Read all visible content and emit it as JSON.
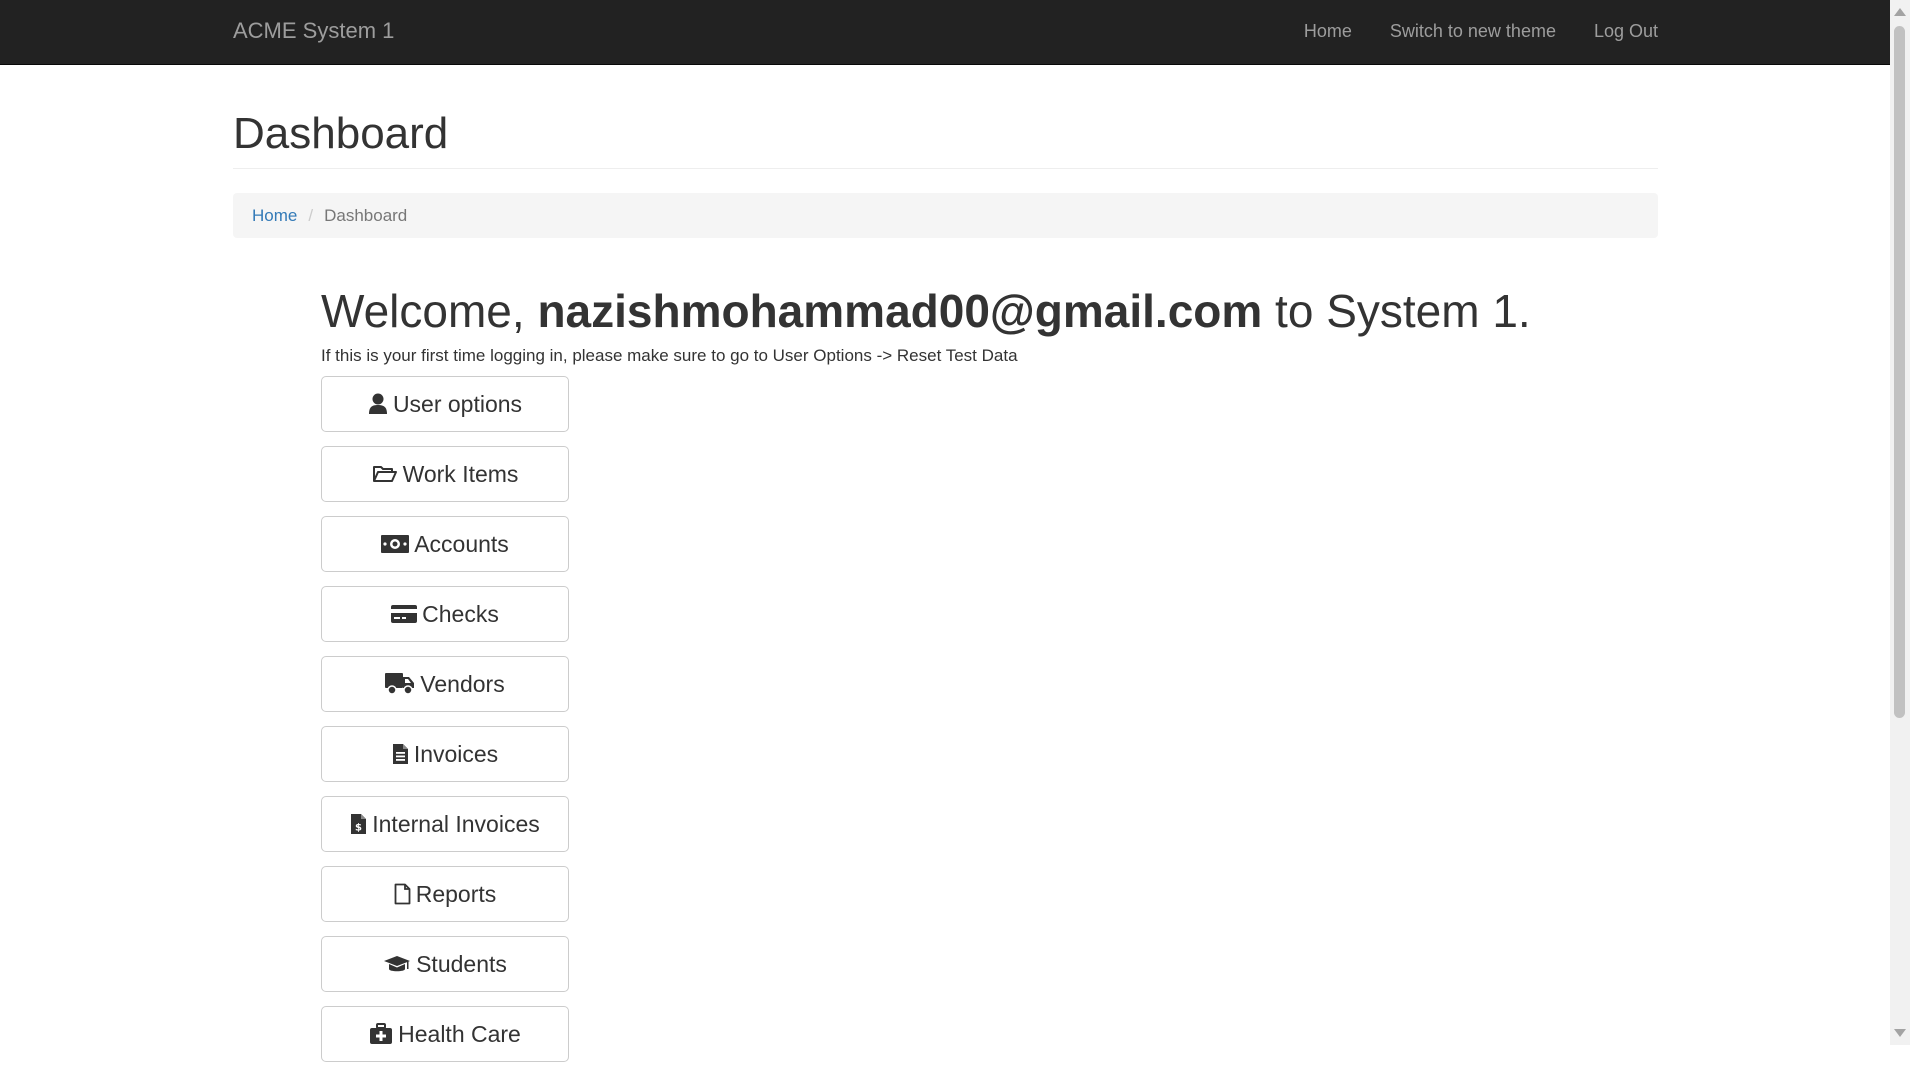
{
  "navbar": {
    "brand": "ACME System 1",
    "links": [
      {
        "label": "Home"
      },
      {
        "label": "Switch to new theme"
      },
      {
        "label": "Log Out"
      }
    ]
  },
  "page": {
    "title": "Dashboard"
  },
  "breadcrumb": {
    "home": "Home",
    "current": "Dashboard"
  },
  "welcome": {
    "prefix": "Welcome, ",
    "user": "nazishmohammad00@gmail.com",
    "suffix": " to System 1.",
    "note": "If this is your first time logging in, please make sure to go to User Options -> Reset Test Data"
  },
  "menu": [
    {
      "label": "User options",
      "icon": "user-icon"
    },
    {
      "label": "Work Items",
      "icon": "folder-open-icon"
    },
    {
      "label": "Accounts",
      "icon": "money-icon"
    },
    {
      "label": "Checks",
      "icon": "credit-card-icon"
    },
    {
      "label": "Vendors",
      "icon": "truck-icon"
    },
    {
      "label": "Invoices",
      "icon": "file-text-icon"
    },
    {
      "label": "Internal Invoices",
      "icon": "file-invoice-dollar-icon"
    },
    {
      "label": "Reports",
      "icon": "file-icon"
    },
    {
      "label": "Students",
      "icon": "graduation-cap-icon"
    },
    {
      "label": "Health Care",
      "icon": "medkit-icon"
    }
  ]
}
